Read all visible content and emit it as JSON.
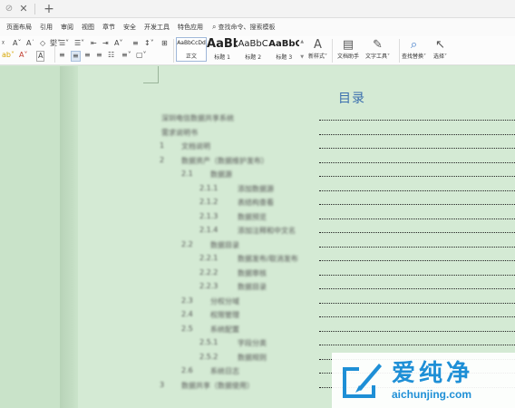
{
  "tabbar": {
    "pin_glyph": "⊘",
    "close_glyph": "✕",
    "new_tab_glyph": "+"
  },
  "menu": {
    "items": [
      "页面布局",
      "引用",
      "审阅",
      "视图",
      "章节",
      "安全",
      "开发工具",
      "特色应用"
    ],
    "search_label": "查找命令、搜索模板"
  },
  "ribbon": {
    "font_row1": [
      "ᵡ",
      "Aˇ",
      "A˙",
      "◇",
      "燮˅"
    ],
    "font_row2": [
      "ab˅",
      "A˅",
      "A"
    ],
    "para_row1": [
      "☰˅",
      "☰˅",
      "⇤",
      "⇥",
      "A˅",
      "≡",
      "↕˅",
      "⊞"
    ],
    "para_row2": [
      "≡",
      "≡",
      "≡",
      "≡",
      "☷",
      "≡˅",
      "▢˅"
    ],
    "styles": [
      {
        "preview": "AaBbCcDd",
        "label": "正文"
      },
      {
        "preview": "AaBb",
        "label": "标题 1"
      },
      {
        "preview": "AaBbC",
        "label": "标题 2"
      },
      {
        "preview": "AaBbC",
        "label": "标题 3"
      }
    ],
    "new_style": "新样式˅",
    "doc_helper": "文档助手",
    "text_tools": "文字工具˅",
    "find_replace": "查找替换˅",
    "select": "选择˅",
    "new_style_glyph": "A",
    "doc_helper_glyph": "▤",
    "text_tools_glyph": "✎",
    "find_glyph": "⌕",
    "select_glyph": "↖"
  },
  "document": {
    "toc_title": "目录",
    "toc": [
      {
        "num": "",
        "text": "深圳电信数据共享系统"
      },
      {
        "num": "",
        "text": "需求说明书"
      },
      {
        "num": "1",
        "text": "文档说明"
      },
      {
        "num": "2",
        "text": "数据资产（数据维护发布）"
      },
      {
        "num": "2.1",
        "text": "数据源"
      },
      {
        "num": "2.1.1",
        "text": "添加数据源"
      },
      {
        "num": "2.1.2",
        "text": "表结构查看"
      },
      {
        "num": "2.1.3",
        "text": "数据预览"
      },
      {
        "num": "2.1.4",
        "text": "添加注释和中文名"
      },
      {
        "num": "2.2",
        "text": "数据目录"
      },
      {
        "num": "2.2.1",
        "text": "数据发布/取消发布"
      },
      {
        "num": "2.2.2",
        "text": "数据审核"
      },
      {
        "num": "2.2.3",
        "text": "数据目录"
      },
      {
        "num": "2.3",
        "text": "分权分域"
      },
      {
        "num": "2.4",
        "text": "权限管理"
      },
      {
        "num": "2.5",
        "text": "系统配置"
      },
      {
        "num": "2.5.1",
        "text": "字段分类"
      },
      {
        "num": "2.5.2",
        "text": "数据规则"
      },
      {
        "num": "2.6",
        "text": "系统日志"
      },
      {
        "num": "3",
        "text": "数据共享（数据使用）"
      },
      {
        "num": "",
        "text": ""
      }
    ]
  },
  "watermark": {
    "brand": "爱纯净",
    "url": "aichunjing.com"
  },
  "colors": {
    "page_bg": "#d4ead4",
    "toc_title": "#3b6fae",
    "brand_blue": "#1e8fd6"
  }
}
